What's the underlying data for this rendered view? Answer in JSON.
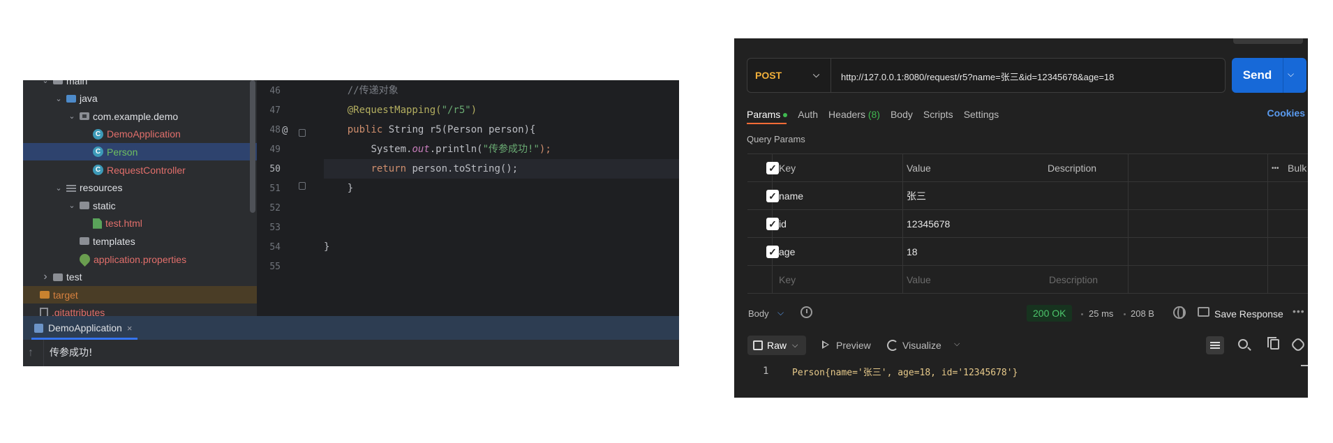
{
  "ide": {
    "tree": [
      {
        "label": "main",
        "indent": 1,
        "icon": "folder-icon",
        "chevron": "down",
        "style": "normal"
      },
      {
        "label": "java",
        "indent": 2,
        "icon": "source-folder-icon",
        "chevron": "down",
        "style": "normal"
      },
      {
        "label": "com.example.demo",
        "indent": 3,
        "icon": "package-icon",
        "chevron": "down",
        "style": "normal"
      },
      {
        "label": "DemoApplication",
        "indent": 4,
        "icon": "class-icon",
        "chevron": "",
        "style": "red"
      },
      {
        "label": "Person",
        "indent": 4,
        "icon": "class-icon",
        "chevron": "",
        "style": "green",
        "selected": true
      },
      {
        "label": "RequestController",
        "indent": 4,
        "icon": "class-icon",
        "chevron": "",
        "style": "red"
      },
      {
        "label": "resources",
        "indent": 2,
        "icon": "resources-folder-icon",
        "chevron": "down",
        "style": "normal"
      },
      {
        "label": "static",
        "indent": 3,
        "icon": "folder-icon",
        "chevron": "down",
        "style": "normal"
      },
      {
        "label": "test.html",
        "indent": 4,
        "icon": "html-file-icon",
        "chevron": "",
        "style": "red"
      },
      {
        "label": "templates",
        "indent": 3,
        "icon": "folder-icon",
        "chevron": "",
        "style": "normal"
      },
      {
        "label": "application.properties",
        "indent": 3,
        "icon": "spring-properties-icon",
        "chevron": "",
        "style": "red"
      },
      {
        "label": "test",
        "indent": 1,
        "icon": "folder-icon",
        "chevron": "right",
        "style": "normal"
      },
      {
        "label": "target",
        "indent": 0,
        "icon": "excluded-folder-icon",
        "chevron": "",
        "style": "orange",
        "excluded": true
      },
      {
        "label": ".gitattributes",
        "indent": 0,
        "icon": "file-icon",
        "chevron": "",
        "style": "red"
      }
    ],
    "line_numbers": [
      "46",
      "47",
      "48",
      "49",
      "50",
      "51",
      "52",
      "53",
      "54",
      "55"
    ],
    "code": {
      "l46_comment": "//传递对象",
      "l47_anno": "@RequestMapping(",
      "l47_str": "\"/r5\"",
      "l47_end": ")",
      "l48_kw": "public",
      "l48_rest": " String r5(Person person){",
      "l49_a": "System.",
      "l49_out": "out",
      "l49_b": ".println(",
      "l49_str": "\"传参成功!\"",
      "l49_c": ");",
      "l50_kw": "return",
      "l50_rest": " person.toString();",
      "l51": "}",
      "l54": "}"
    },
    "gutter_at": "@",
    "run_tab_label": "DemoApplication",
    "run_tab_close": "×",
    "console_output": "传参成功!",
    "console_up": "↑"
  },
  "postman": {
    "method": "POST",
    "method_chevron": "⌵",
    "url": "http://127.0.0.1:8080/request/r5?name=张三&id=12345678&age=18",
    "send_label": "Send",
    "send_chevron": "⌵",
    "tabs": [
      {
        "label": "Params",
        "active": true,
        "dot": true
      },
      {
        "label": "Auth"
      },
      {
        "label": "Headers",
        "count": "(8)"
      },
      {
        "label": "Body"
      },
      {
        "label": "Scripts"
      },
      {
        "label": "Settings"
      }
    ],
    "cookies_label": "Cookies",
    "query_params_title": "Query Params",
    "table_headers": {
      "key": "Key",
      "value": "Value",
      "description": "Description",
      "bulk_edit": "Bulk Edit",
      "more": "•••"
    },
    "params": [
      {
        "key": "name",
        "value": "张三",
        "checked": true
      },
      {
        "key": "id",
        "value": "12345678",
        "checked": true
      },
      {
        "key": "age",
        "value": "18",
        "checked": true
      }
    ],
    "placeholders": {
      "key": "Key",
      "value": "Value",
      "description": "Description"
    },
    "check_mark": "✓",
    "response": {
      "body_label": "Body",
      "body_chevron": "⌵",
      "status": "200 OK",
      "time": "25 ms",
      "size": "208 B",
      "save_response": "Save Response",
      "more": "•••",
      "raw_label": "Raw",
      "raw_chevron": "⌵",
      "preview_label": "Preview",
      "visualize_label": "Visualize",
      "visualize_chevron": "⌵",
      "line_number": "1",
      "body_text": "Person{name='张三', age=18, id='12345678'}"
    }
  }
}
